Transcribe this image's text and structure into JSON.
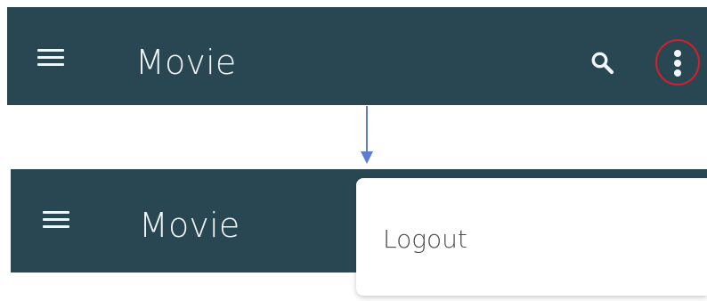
{
  "top_appbar": {
    "title": "Movie",
    "icons": {
      "menu": "hamburger-menu-icon",
      "search": "search-icon",
      "more": "more-vert-icon"
    },
    "highlight_color": "#d71f26"
  },
  "bottom_appbar": {
    "title": "Movie",
    "icons": {
      "menu": "hamburger-menu-icon"
    }
  },
  "dropdown": {
    "items": [
      {
        "label": "Logout"
      }
    ]
  },
  "colors": {
    "appbar_bg": "#294753",
    "appbar_fg": "#f3f6f7",
    "arrow": "#5b7bd4",
    "dropdown_bg": "#ffffff",
    "dropdown_text": "#4c4c4c"
  }
}
